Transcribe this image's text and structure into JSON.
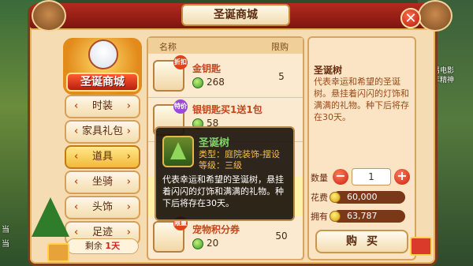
{
  "window": {
    "title": "圣诞商城",
    "close_label": "✕"
  },
  "background": {
    "left_labels": [
      "当",
      "当"
    ],
    "right_labels": [
      "网易电影",
      "今年精神"
    ]
  },
  "logo": {
    "text": "圣诞商城"
  },
  "menu": {
    "items": [
      {
        "label": "时装",
        "active": false
      },
      {
        "label": "家具礼包",
        "active": false
      },
      {
        "label": "道具",
        "active": true
      },
      {
        "label": "坐骑",
        "active": false
      },
      {
        "label": "头饰",
        "active": false
      },
      {
        "label": "足迹",
        "active": false
      }
    ],
    "remain_label": "剩余",
    "remain_value": "1天"
  },
  "list": {
    "headers": {
      "name": "名称",
      "limit": "限购"
    },
    "items": [
      {
        "name": "金钥匙",
        "price": "268",
        "limit": "5",
        "tag": "折扣",
        "icon": "gold-key-icon"
      },
      {
        "name": "银钥匙买1送1包",
        "price": "58",
        "limit": "",
        "tag": "特价",
        "icon": "silver-key-bag-icon"
      },
      {
        "name": "宠物积分券",
        "price": "20",
        "limit": "50",
        "tag": "限量",
        "icon": "pet-coupon-icon"
      }
    ]
  },
  "tooltip": {
    "name": "圣诞树",
    "type": "类型：庭院装饰-摆设",
    "level": "等级：三级",
    "desc": "代表幸运和希望的圣诞树，悬挂着闪闪的灯饰和满满的礼物。种下后将存在30天。",
    "icon": "christmas-tree-icon"
  },
  "detail": {
    "name": "圣诞树",
    "desc": "代表幸运和希望的圣诞树。悬挂着闪闪的灯饰和满满的礼物。种下后将存在30天。",
    "qty_label": "数量",
    "qty_value": "1",
    "cost_label": "花费",
    "cost_value": "60,000",
    "own_label": "拥有",
    "own_value": "63,787",
    "buy_label": "购买"
  },
  "colors": {
    "accent": "#b32a1e",
    "panel": "#f6dcb2",
    "highlight": "#f2b93a",
    "name_color": "#c4461a"
  }
}
